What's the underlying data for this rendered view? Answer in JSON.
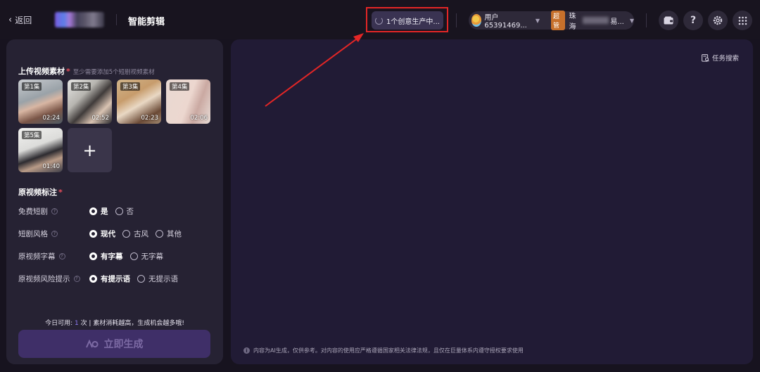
{
  "header": {
    "back_label": "返回",
    "app_title": "智能剪辑",
    "task_status": "1个创意生产中...",
    "user_name": "用户65391469...",
    "role_badge": "超管",
    "org_name": "珠海",
    "org_tail": "易..."
  },
  "upload": {
    "title": "上传视频素材",
    "required_mark": "*",
    "hint": "至少需要添加5个短剧视频素材",
    "items": [
      {
        "episode": "第1集",
        "duration": "02:24"
      },
      {
        "episode": "第2集",
        "duration": "02:52"
      },
      {
        "episode": "第3集",
        "duration": "02:23"
      },
      {
        "episode": "第4集",
        "duration": "02:06"
      },
      {
        "episode": "第5集",
        "duration": "01:40"
      }
    ],
    "add_symbol": "+"
  },
  "annotation": {
    "title": "原视频标注",
    "required_mark": "*",
    "rows": [
      {
        "label": "免费短剧",
        "options": [
          "是",
          "否"
        ],
        "selected": 0
      },
      {
        "label": "短剧风格",
        "options": [
          "现代",
          "古风",
          "其他"
        ],
        "selected": 0
      },
      {
        "label": "原视频字幕",
        "options": [
          "有字幕",
          "无字幕"
        ],
        "selected": 0
      },
      {
        "label": "原视频风险提示",
        "options": [
          "有提示语",
          "无提示语"
        ],
        "selected": 0
      }
    ],
    "help_symbol": "?"
  },
  "quota": {
    "prefix": "今日可用: ",
    "count": "1",
    "suffix": " 次 | 素材消耗越高，生成机会越多哦!"
  },
  "generate_button": "立即生成",
  "right_panel": {
    "task_search_label": "任务搜索",
    "disclaimer": "内容为AI生成，仅供参考。对内容的使用应严格遵循国家相关法律法规，且仅在巨量体系内遵守授权要求使用"
  },
  "colors": {
    "accent": "#8f7cf5",
    "highlight": "#e32626",
    "badge": "#c7702b",
    "generate_button_bg": "#3f2f68"
  },
  "icons": [
    "chevron-left-icon",
    "spinner-icon",
    "caret-down-icon",
    "wallet-icon",
    "help-icon",
    "settings-icon",
    "apps-grid-icon",
    "plus-icon",
    "radio-icon",
    "question-icon",
    "info-icon",
    "search-doc-icon",
    "ai-logo-icon"
  ]
}
